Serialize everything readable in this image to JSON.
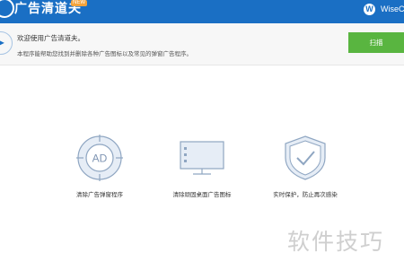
{
  "app": {
    "title": "广告清道夫",
    "badge": "NEW",
    "brand_initial": "W",
    "brand_name": "WiseCle"
  },
  "welcome": {
    "heading": "欢迎使用广告清道夫。",
    "description": "本程序能帮助您找到并删除各种广告图标以及常见的弹窗广告程序。",
    "scan_button": "扫描"
  },
  "features": [
    {
      "label": "清除广告弹窗程序",
      "icon": "ad-target-icon",
      "icon_text": "AD"
    },
    {
      "label": "清除顽固桌面广告图标",
      "icon": "monitor-icon"
    },
    {
      "label": "实时保护，防止再次感染",
      "icon": "shield-check-icon"
    }
  ],
  "watermark": "软件技巧",
  "colors": {
    "titlebar": "#1a6fc4",
    "scan_button": "#59b540",
    "icon_stroke": "#8fa6c2",
    "icon_fill": "#e6edf6"
  }
}
